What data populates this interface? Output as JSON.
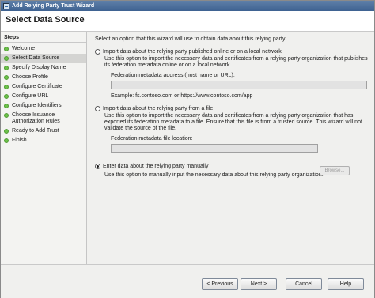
{
  "window": {
    "title": "Add Relying Party Trust Wizard"
  },
  "header": {
    "title": "Select Data Source"
  },
  "steps": {
    "title": "Steps",
    "items": [
      {
        "label": "Welcome"
      },
      {
        "label": "Select Data Source"
      },
      {
        "label": "Specify Display Name"
      },
      {
        "label": "Choose Profile"
      },
      {
        "label": "Configure Certificate"
      },
      {
        "label": "Configure URL"
      },
      {
        "label": "Configure Identifiers"
      },
      {
        "label": "Choose Issuance Authorization Rules"
      },
      {
        "label": "Ready to Add Trust"
      },
      {
        "label": "Finish"
      }
    ]
  },
  "main": {
    "intro": "Select an option that this wizard will use to obtain data about this relying party:",
    "option1": {
      "label": "Import data about the relying party published online or on a local network",
      "description": "Use this option to import the necessary data and certificates from a relying party organization that publishes its federation metadata online or on a local network.",
      "field_label": "Federation metadata address (host name or URL):",
      "field_value": "",
      "example": "Example: fs.contoso.com or https://www.contoso.com/app",
      "checked": false
    },
    "option2": {
      "label": "Import data about the relying party from a file",
      "description": "Use this option to import the necessary data and certificates from a relying party organization that has exported its federation metadata to a file. Ensure that this file is from a trusted source. This wizard will not validate the source of the file.",
      "field_label": "Federation metadata file location:",
      "field_value": "",
      "browse_label": "Browse...",
      "checked": false
    },
    "option3": {
      "label": "Enter data about the relying party manually",
      "description": "Use this option to manually input the necessary data about this relying party organization.",
      "checked": true
    }
  },
  "footer": {
    "previous_label": "< Previous",
    "next_label": "Next >",
    "cancel_label": "Cancel",
    "help_label": "Help"
  },
  "colors": {
    "titlebar": "#3e6291",
    "step_dot": "#6cc24a",
    "current_step_bg": "#d4d4d2"
  }
}
